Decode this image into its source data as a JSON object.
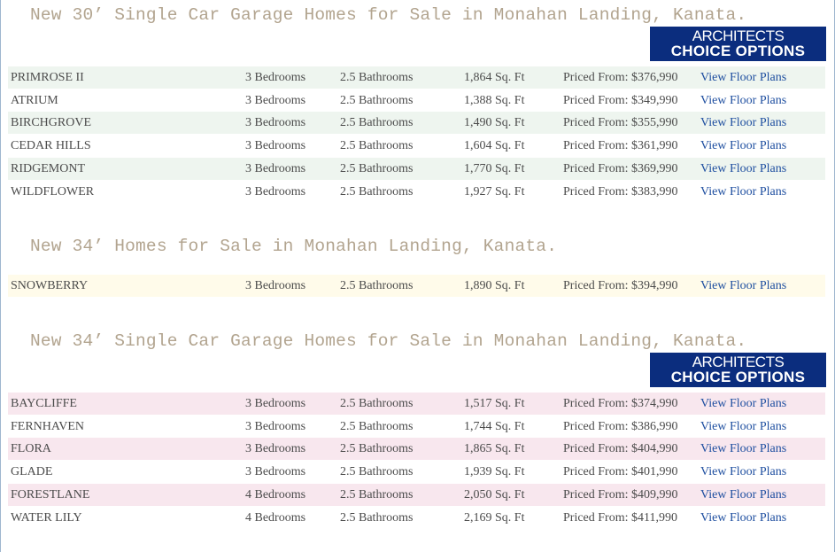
{
  "sections": [
    {
      "heading": "New 30’ Single Car Garage Homes for Sale in Monahan Landing, Kanata.",
      "badge": {
        "line1": "ARCHITECTS",
        "line2": "CHOICE OPTIONS"
      },
      "rows": [
        {
          "name": "PRIMROSE II",
          "bedrooms": "3  Bedrooms",
          "bathrooms": "2.5  Bathrooms",
          "sqft": "1,864 Sq. Ft",
          "price": "Priced From: $376,990",
          "link": "View Floor Plans"
        },
        {
          "name": "ATRIUM",
          "bedrooms": "3  Bedrooms",
          "bathrooms": "2.5  Bathrooms",
          "sqft": "1,388 Sq. Ft",
          "price": "Priced From: $349,990",
          "link": "View Floor Plans"
        },
        {
          "name": "BIRCHGROVE",
          "bedrooms": "3  Bedrooms",
          "bathrooms": "2.5  Bathrooms",
          "sqft": "1,490 Sq. Ft",
          "price": "Priced From: $355,990",
          "link": "View Floor Plans"
        },
        {
          "name": "CEDAR HILLS",
          "bedrooms": "3  Bedrooms",
          "bathrooms": "2.5  Bathrooms",
          "sqft": "1,604 Sq. Ft",
          "price": "Priced From: $361,990",
          "link": "View Floor Plans"
        },
        {
          "name": "RIDGEMONT",
          "bedrooms": "3  Bedrooms",
          "bathrooms": "2.5  Bathrooms",
          "sqft": "1,770 Sq. Ft",
          "price": "Priced From: $369,990",
          "link": "View Floor Plans"
        },
        {
          "name": "WILDFLOWER",
          "bedrooms": "3  Bedrooms",
          "bathrooms": "2.5  Bathrooms",
          "sqft": "1,927 Sq. Ft",
          "price": "Priced From: $383,990",
          "link": "View Floor Plans"
        }
      ]
    },
    {
      "heading": "New 34’ Homes for Sale in Monahan Landing, Kanata.",
      "rows": [
        {
          "name": "SNOWBERRY",
          "bedrooms": "3  Bedrooms",
          "bathrooms": "2.5  Bathrooms",
          "sqft": "1,890 Sq. Ft",
          "price": "Priced From: $394,990",
          "link": "View Floor Plans"
        }
      ]
    },
    {
      "heading": "New 34’ Single Car Garage Homes for Sale in Monahan Landing, Kanata.",
      "badge": {
        "line1": "ARCHITECTS",
        "line2": "CHOICE OPTIONS"
      },
      "rows": [
        {
          "name": "BAYCLIFFE",
          "bedrooms": "3  Bedrooms",
          "bathrooms": "2.5  Bathrooms",
          "sqft": "1,517 Sq. Ft",
          "price": "Priced From: $374,990",
          "link": "View Floor Plans"
        },
        {
          "name": "FERNHAVEN",
          "bedrooms": "3  Bedrooms",
          "bathrooms": "2.5  Bathrooms",
          "sqft": "1,744 Sq. Ft",
          "price": "Priced From: $386,990",
          "link": "View Floor Plans"
        },
        {
          "name": "FLORA",
          "bedrooms": "3  Bedrooms",
          "bathrooms": "2.5  Bathrooms",
          "sqft": "1,865 Sq. Ft",
          "price": "Priced From: $404,990",
          "link": "View Floor Plans"
        },
        {
          "name": "GLADE",
          "bedrooms": "3  Bedrooms",
          "bathrooms": "2.5  Bathrooms",
          "sqft": "1,939 Sq. Ft",
          "price": "Priced From: $401,990",
          "link": "View Floor Plans"
        },
        {
          "name": "FORESTLANE",
          "bedrooms": "4  Bedrooms",
          "bathrooms": "2.5  Bathrooms",
          "sqft": "2,050 Sq. Ft",
          "price": "Priced From: $409,990",
          "link": "View Floor Plans"
        },
        {
          "name": "WATER LILY",
          "bedrooms": "4  Bedrooms",
          "bathrooms": "2.5  Bathrooms",
          "sqft": "2,169 Sq. Ft",
          "price": "Priced From: $411,990",
          "link": "View Floor Plans"
        }
      ]
    }
  ]
}
